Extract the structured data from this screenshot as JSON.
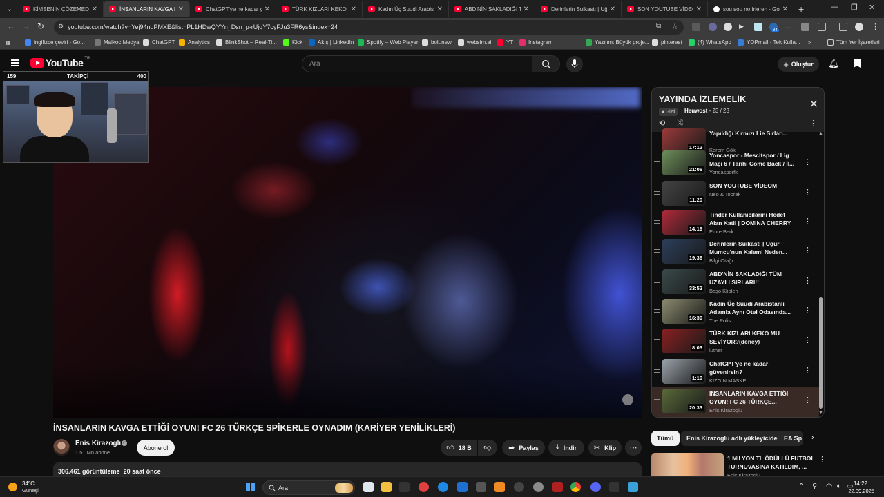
{
  "browser": {
    "tabs": [
      {
        "title": "KİMSENİN ÇÖZEMEDİĞİ",
        "active": false,
        "icon": "youtube-icon"
      },
      {
        "title": "İNSANLARIN KAVGA ET",
        "active": true,
        "icon": "youtube-icon"
      },
      {
        "title": "ChatGPT'ye ne kadar gü",
        "active": false,
        "icon": "youtube-icon"
      },
      {
        "title": "TÜRK KIZLARI KEKO MU",
        "active": false,
        "icon": "youtube-icon"
      },
      {
        "title": "Kadın Üç Suudi Arabista",
        "active": false,
        "icon": "youtube-icon"
      },
      {
        "title": "ABD'NİN SAKLADIĞI TÜ",
        "active": false,
        "icon": "youtube-icon"
      },
      {
        "title": "Derinlerin Suikastı | Uğu",
        "active": false,
        "icon": "youtube-icon"
      },
      {
        "title": "SON YOUTUBE VİDEOM",
        "active": false,
        "icon": "youtube-icon"
      },
      {
        "title": "sou sou no frieren - Goo",
        "active": false,
        "icon": "google-icon"
      }
    ],
    "url": "youtube.com/watch?v=Yej94ndPMXE&list=PL1HDwQYYn_Dsn_p-rUjqY7cyFJu3FR6ys&index=24",
    "bookmarks": [
      "ingilizce çeviri - Go...",
      "Malkoc Medya",
      "ChatGPT",
      "Analytics",
      "BlinkShot – Real-Ti...",
      "Kick",
      "Akış | LinkedIn",
      "Spotify – Web Player",
      "bolt.new",
      "websim.ai",
      "YT",
      "Instagram",
      "Yazılım: Büyük proje...",
      "pinterest",
      "(4) WhatsApp",
      "YOPmail - Tek Kulla..."
    ],
    "all_bookmarks_label": "Tüm Yer İşaretleri",
    "ext_badge": "34"
  },
  "youtube": {
    "logo_text": "YouTube",
    "logo_region": "TR",
    "search_placeholder": "Ara",
    "create_label": "Oluştur"
  },
  "overlay": {
    "left_count": "159",
    "center_label": "TAKİPÇİ",
    "right_count": "400"
  },
  "video": {
    "title": "İNSANLARIN KAVGA ETTİĞİ OYUN! FC 26 TÜRKÇE SPİKERLE OYNADIM (KARİYER YENİLİKLERİ)",
    "channel": "Enis Kirazoglu",
    "subscribers": "1,51 Mn abone",
    "subscribe_label": "Abone ol",
    "likes": "18 B",
    "share_label": "Paylaş",
    "download_label": "İndir",
    "clip_label": "Klip",
    "views": "306.461 görüntüleme",
    "time_ago": "20 saat önce"
  },
  "playlist": {
    "title": "YAYINDA İZLEMELİK",
    "privacy": "Gizli",
    "owner": "Heuwost",
    "position": "23 / 23",
    "items": [
      {
        "title": "Yapıldığı Kırmızı Lie Sırları...",
        "channel": "Kerem Gök",
        "duration": "17:12",
        "color": "#9a3a3a"
      },
      {
        "title": "Yoncaspor - Mescitspor / Lig Maçı 6 / Tarihi Come Back / İl...",
        "channel": "Yoncasporfk",
        "duration": "21:06",
        "color": "#6d8e5a"
      },
      {
        "title": "SON YOUTUBE VİDEOM",
        "channel": "Neo & Toprak",
        "duration": "11:20",
        "color": "#444444"
      },
      {
        "title": "Tinder Kullanıcılarını Hedef Alan Katil | DOMINA CHERRY",
        "channel": "Emre Berk",
        "duration": "14:19",
        "color": "#b02a3a"
      },
      {
        "title": "Derinlerin Suikastı | Uğur Mumcu'nun Kalemi Neden...",
        "channel": "Bilgi Otağı",
        "duration": "19:36",
        "color": "#2c3f5c"
      },
      {
        "title": "ABD'NİN SAKLADIĞI TÜM UZAYLI SIRLARI!!",
        "channel": "Başo Klipleri",
        "duration": "33:52",
        "color": "#3a4a4a"
      },
      {
        "title": "Kadın Üç Suudi Arabistanlı Adamla Aynı Otel Odasında...",
        "channel": "The Polis",
        "duration": "16:39",
        "color": "#8c8c70"
      },
      {
        "title": "TÜRK KIZLARI KEKO MU SEVİYOR?(deney)",
        "channel": "luther",
        "duration": "8:03",
        "color": "#8a2020"
      },
      {
        "title": "ChatGPT'ye ne kadar güvenirsin?",
        "channel": "KIZGIN MASKE",
        "duration": "1:19",
        "color": "#9aa2aa"
      },
      {
        "title": "İNSANLARIN KAVGA ETTİĞİ OYUN! FC 26 TÜRKÇE...",
        "channel": "Enis Kirazoglu",
        "duration": "20:33",
        "color": "#5a6a3a"
      }
    ]
  },
  "chips": [
    "Tümü",
    "Enis Kirazoglu adlı yükleyiciden",
    "EA Sp"
  ],
  "recommendation": {
    "title": "1 MİLYON TL ÖDÜLLÜ FUTBOL TURNUVASINA KATILDIM, ...",
    "channel": "Enis Kirazoglu"
  },
  "taskbar": {
    "temp": "34°C",
    "weather": "Güneşli",
    "search_placeholder": "Ara",
    "time": "14:22",
    "date": "22.09.2025"
  }
}
